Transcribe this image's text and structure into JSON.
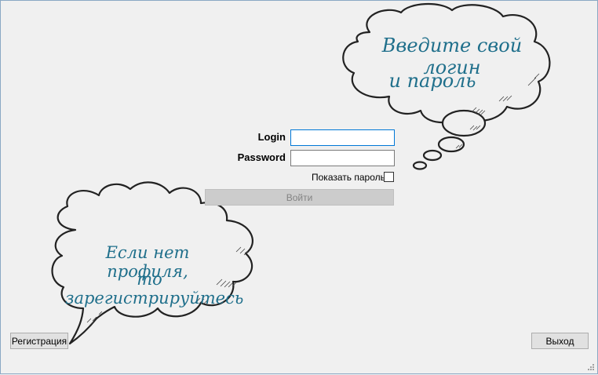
{
  "hints": {
    "top_line1": "Введите свой логин",
    "top_line2": "и пароль",
    "bottom_line1": "Если нет профиля,",
    "bottom_line2": "то зарегистрируйтесь"
  },
  "form": {
    "login_label": "Login",
    "login_value": "",
    "password_label": "Password",
    "password_value": "",
    "show_password_label": "Показать пароль",
    "show_password_checked": false,
    "submit_label": "Войти"
  },
  "footer": {
    "register_label": "Регистрация",
    "exit_label": "Выход"
  },
  "colors": {
    "hint_text": "#1f6f8b",
    "focus_border": "#0078d7",
    "disabled_button": "#cccccc"
  }
}
